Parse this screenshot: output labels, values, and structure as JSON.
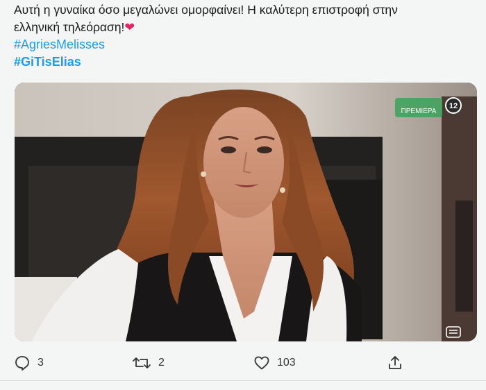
{
  "tweet": {
    "text_line1": "Αυτή η γυναίκα όσο μεγαλώνει ομορφαίνει! Η καλύτερη επιστροφή στην",
    "text_line2": "ελληνική τηλεόραση!",
    "emoji": "❤",
    "hashtags": [
      "#AgriesMelisses",
      "#GiTisElias"
    ]
  },
  "media": {
    "channel_logo": "ΠΡΕΜΙΕΡΑ",
    "rating": "12"
  },
  "actions": {
    "replies": "3",
    "retweets": "2",
    "likes": "103"
  },
  "icons": {
    "reply": "reply-icon",
    "retweet": "retweet-icon",
    "like": "heart-icon",
    "share": "share-icon",
    "subtitles": "subtitles-icon"
  },
  "colors": {
    "link": "#1d9bf0",
    "heart": "#e0245e",
    "text": "#1a1a1a"
  }
}
